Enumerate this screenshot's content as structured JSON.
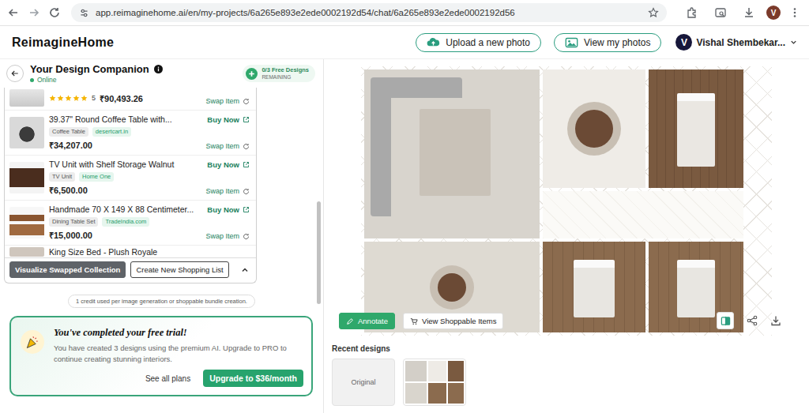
{
  "browser": {
    "url": "app.reimaginehome.ai/en/my-projects/6a265e893e2ede0002192d54/chat/6a265e893e2ede0002192d56",
    "profile": "V"
  },
  "header": {
    "logo": "ReimagineHome",
    "actions": [
      "Upload a new photo",
      "View my photos"
    ],
    "user": {
      "initial": "V",
      "name": "Vishal Shembekar..."
    }
  },
  "chat": {
    "title": "Your Design Companion",
    "status": "Online",
    "online": true,
    "credits": {
      "count": "0/3 Free Designs",
      "label": "REMAINING"
    }
  },
  "products": [
    {
      "kind": "rated",
      "stars": 5,
      "rating": "5",
      "price": "₹90,493.26",
      "swap": "Swap Item"
    },
    {
      "kind": "item",
      "title": "39.37\" Round Coffee Table with...",
      "tags": [
        {
          "label": "Coffee Table",
          "kind": "category"
        },
        {
          "label": "desertcart.in",
          "kind": "store"
        }
      ],
      "price": "₹34,207.00",
      "buy": "Buy Now",
      "swap": "Swap Item"
    },
    {
      "kind": "item",
      "title": "TV Unit with Shelf Storage Walnut",
      "tags": [
        {
          "label": "TV Unit",
          "kind": "category"
        },
        {
          "label": "Home One",
          "kind": "store"
        }
      ],
      "price": "₹6,500.00",
      "buy": "Buy Now",
      "swap": "Swap Item"
    },
    {
      "kind": "item",
      "title": "Handmade 70 X 149 X 88 Centimeter...",
      "tags": [
        {
          "label": "Dining Table Set",
          "kind": "category"
        },
        {
          "label": "TradeIndia.com",
          "kind": "store"
        }
      ],
      "price": "₹15,000.00",
      "buy": "Buy Now",
      "swap": "Swap Item"
    },
    {
      "kind": "cut",
      "title": "King Size Bed - Plush Royale"
    }
  ],
  "list_actions": [
    {
      "label": "Visualize Swapped Collection",
      "primary": true
    },
    {
      "label": "Create New Shopping List",
      "primary": false
    }
  ],
  "note": "1 credit used per image generation or shoppable bundle creation.",
  "trial": {
    "title": "You've completed your free trial!",
    "body": "You have created 3 designs using the premium AI. Upgrade to PRO to continue creating stunning interiors.",
    "link": "See all plans",
    "button": "Upgrade to $36/month"
  },
  "canvas": {
    "actions": [
      {
        "label": "Annotate",
        "primary": true
      },
      {
        "label": "View Shoppable Items",
        "primary": false
      }
    ]
  },
  "recent": {
    "title": "Recent designs",
    "items": [
      {
        "kind": "original",
        "label": "Original"
      },
      {
        "kind": "design"
      }
    ]
  }
}
